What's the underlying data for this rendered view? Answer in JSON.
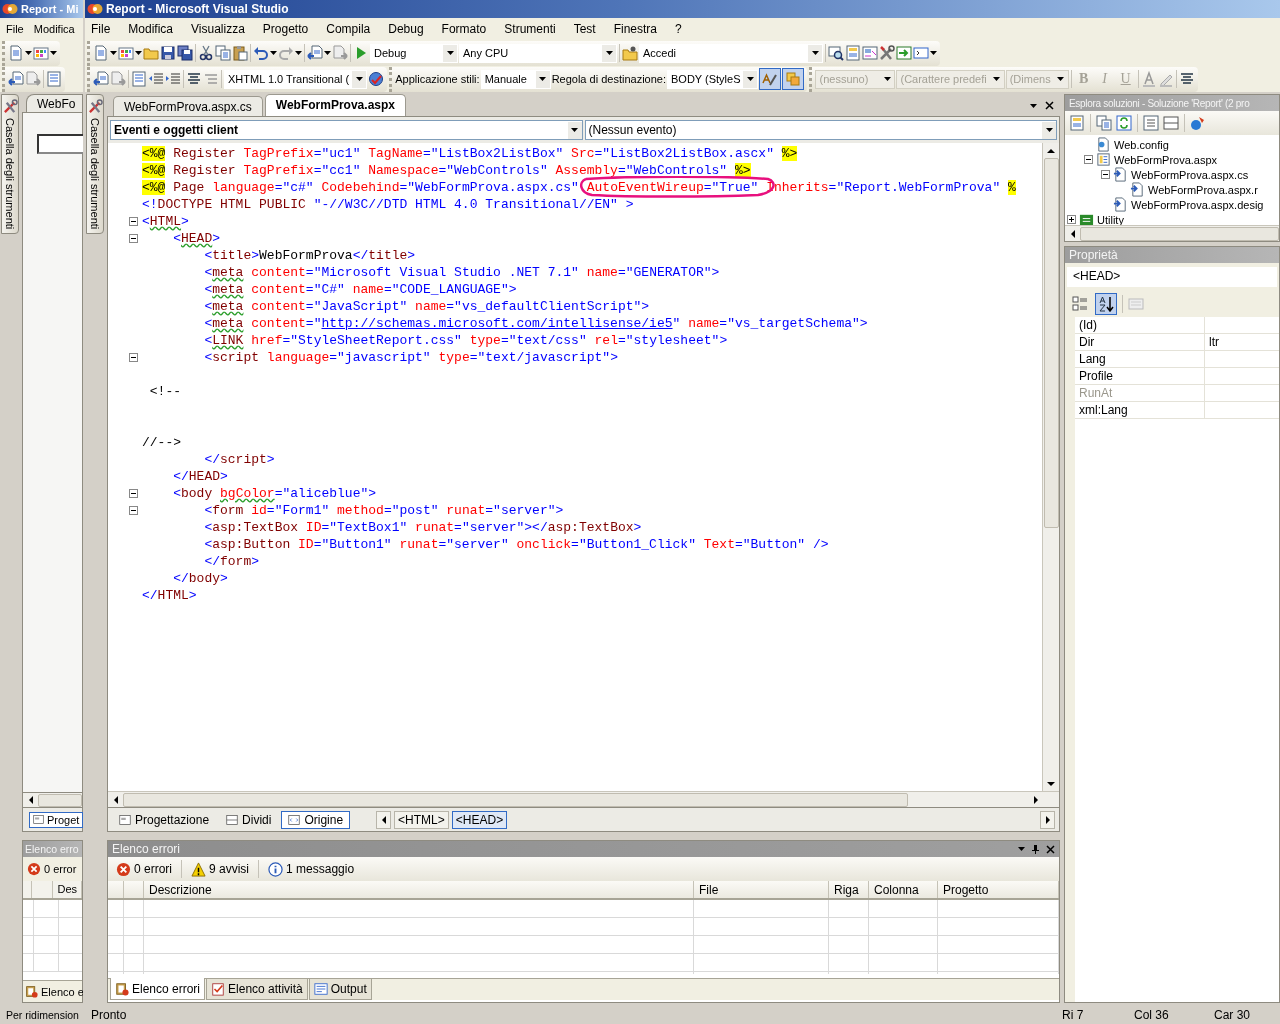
{
  "background_window": {
    "title": "Report - Mi",
    "menu": [
      "File",
      "Modifica"
    ],
    "toolbox_label": "Casella degli strumenti",
    "document_tab": "WebFo",
    "view_tab": "Proget",
    "error_list": {
      "title": "Elenco erro",
      "errors": "0 error",
      "column": "Des",
      "tab": "Elenco e"
    },
    "status": "Per ridimension"
  },
  "window": {
    "title": "Report - Microsoft Visual Studio"
  },
  "menu": [
    "File",
    "Modifica",
    "Visualizza",
    "Progetto",
    "Compila",
    "Debug",
    "Formato",
    "Strumenti",
    "Test",
    "Finestra",
    "?"
  ],
  "toolbars": [
    {
      "items": [
        {
          "kind": "combo",
          "value": "Debug",
          "disabled": false
        },
        {
          "kind": "combo",
          "value": "Any CPU",
          "disabled": false
        },
        {
          "kind": "combo",
          "value": "Accedi",
          "disabled": false
        }
      ]
    },
    {
      "items": [
        {
          "kind": "combo",
          "value": "XHTML 1.0 Transitional (",
          "disabled": false
        },
        {
          "kind": "label",
          "text": "Applicazione stili:"
        },
        {
          "kind": "combo",
          "value": "Manuale",
          "disabled": false
        },
        {
          "kind": "label",
          "text": "Regola di destinazione:"
        },
        {
          "kind": "combo",
          "value": "BODY (StyleS",
          "disabled": false
        },
        {
          "kind": "toggle",
          "on": true
        },
        {
          "kind": "toggle",
          "on": true
        },
        {
          "kind": "combo",
          "value": "(nessuno)",
          "disabled": true
        },
        {
          "kind": "combo",
          "value": "(Carattere predefi",
          "disabled": true
        },
        {
          "kind": "combo",
          "value": "(Dimens",
          "disabled": true
        },
        {
          "kind": "button",
          "label": "B",
          "disabled": true
        },
        {
          "kind": "button",
          "label": "I",
          "disabled": true
        },
        {
          "kind": "button",
          "label": "U",
          "disabled": true
        }
      ]
    }
  ],
  "toolbox_label": "Casella degli strumenti",
  "document_tabs": [
    {
      "label": "WebFormProva.aspx.cs",
      "selected": false
    },
    {
      "label": "WebFormProva.aspx",
      "selected": true
    }
  ],
  "object_combo": "Eventi e oggetti client",
  "event_combo": "(Nessun evento)",
  "code_lines": [
    {
      "fold": false,
      "tokens": [
        {
          "text": "<%@",
          "kind": "directive"
        },
        {
          "text": " Register",
          "kind": "tag"
        },
        {
          "text": " TagPrefix",
          "kind": "attr"
        },
        {
          "text": "=\"uc1\"",
          "kind": "value"
        },
        {
          "text": " TagName",
          "kind": "attr"
        },
        {
          "text": "=\"ListBox2ListBox\"",
          "kind": "value"
        },
        {
          "text": " Src",
          "kind": "attr"
        },
        {
          "text": "=\"ListBox2ListBox.ascx\" ",
          "kind": "value"
        },
        {
          "text": "%>",
          "kind": "directive"
        }
      ]
    },
    {
      "fold": false,
      "tokens": [
        {
          "text": "<%@",
          "kind": "directive"
        },
        {
          "text": " Register",
          "kind": "tag"
        },
        {
          "text": " TagPrefix",
          "kind": "attr"
        },
        {
          "text": "=\"cc1\"",
          "kind": "value"
        },
        {
          "text": " Namespace",
          "kind": "attr"
        },
        {
          "text": "=\"WebControls\"",
          "kind": "value"
        },
        {
          "text": " Assembly",
          "kind": "attr"
        },
        {
          "text": "=\"WebControls\" ",
          "kind": "value"
        },
        {
          "text": "%>",
          "kind": "directive"
        }
      ]
    },
    {
      "fold": false,
      "tokens": [
        {
          "text": "<%@",
          "kind": "directive"
        },
        {
          "text": " Page",
          "kind": "tag"
        },
        {
          "text": " language",
          "kind": "attr"
        },
        {
          "text": "=\"c#\"",
          "kind": "value"
        },
        {
          "text": " Codebehind",
          "kind": "attr"
        },
        {
          "text": "=\"WebFormProva.aspx.cs\"",
          "kind": "value"
        },
        {
          "text": " AutoEventWireup",
          "kind": "attr"
        },
        {
          "text": "=\"True\"",
          "kind": "value"
        },
        {
          "text": " Inherits",
          "kind": "attr"
        },
        {
          "text": "=\"Report.WebFormProva\" ",
          "kind": "value"
        },
        {
          "text": "%",
          "kind": "directive"
        }
      ]
    },
    {
      "fold": false,
      "tokens": [
        {
          "text": "<!",
          "kind": "delim"
        },
        {
          "text": "DOCTYPE HTML PUBLIC",
          "kind": "tag"
        },
        {
          "text": " \"-//W3C//DTD HTML 4.0 Transitional//EN\"",
          "kind": "value"
        },
        {
          "text": " >",
          "kind": "delim"
        }
      ]
    },
    {
      "fold": true,
      "tokens": [
        {
          "text": "<",
          "kind": "delim"
        },
        {
          "text": "HTML",
          "kind": "tagwarn"
        },
        {
          "text": ">",
          "kind": "delim"
        }
      ]
    },
    {
      "fold": true,
      "tokens": [
        {
          "text": "    <",
          "kind": "delim"
        },
        {
          "text": "HEAD",
          "kind": "tagwarn"
        },
        {
          "text": ">",
          "kind": "delim"
        }
      ]
    },
    {
      "fold": false,
      "tokens": [
        {
          "text": "        <",
          "kind": "delim"
        },
        {
          "text": "title",
          "kind": "tag"
        },
        {
          "text": ">",
          "kind": "delim"
        },
        {
          "text": "WebFormProva",
          "kind": "text"
        },
        {
          "text": "</",
          "kind": "delim"
        },
        {
          "text": "title",
          "kind": "tag"
        },
        {
          "text": ">",
          "kind": "delim"
        }
      ]
    },
    {
      "fold": false,
      "tokens": [
        {
          "text": "        <",
          "kind": "delim"
        },
        {
          "text": "meta",
          "kind": "tagwarn"
        },
        {
          "text": " content",
          "kind": "attr"
        },
        {
          "text": "=\"Microsoft Visual Studio .NET 7.1\"",
          "kind": "value"
        },
        {
          "text": " name",
          "kind": "attr"
        },
        {
          "text": "=\"GENERATOR\"",
          "kind": "value"
        },
        {
          "text": ">",
          "kind": "delim"
        }
      ]
    },
    {
      "fold": false,
      "tokens": [
        {
          "text": "        <",
          "kind": "delim"
        },
        {
          "text": "meta",
          "kind": "tagwarn"
        },
        {
          "text": " content",
          "kind": "attr"
        },
        {
          "text": "=\"C#\"",
          "kind": "value"
        },
        {
          "text": " name",
          "kind": "attr"
        },
        {
          "text": "=\"CODE_LANGUAGE\"",
          "kind": "value"
        },
        {
          "text": ">",
          "kind": "delim"
        }
      ]
    },
    {
      "fold": false,
      "tokens": [
        {
          "text": "        <",
          "kind": "delim"
        },
        {
          "text": "meta",
          "kind": "tagwarn"
        },
        {
          "text": " content",
          "kind": "attr"
        },
        {
          "text": "=\"JavaScript\"",
          "kind": "value"
        },
        {
          "text": " name",
          "kind": "attr"
        },
        {
          "text": "=\"vs_defaultClientScript\"",
          "kind": "value"
        },
        {
          "text": ">",
          "kind": "delim"
        }
      ]
    },
    {
      "fold": false,
      "tokens": [
        {
          "text": "        <",
          "kind": "delim"
        },
        {
          "text": "meta",
          "kind": "tagwarn"
        },
        {
          "text": " content",
          "kind": "attr"
        },
        {
          "text": "=\"",
          "kind": "value"
        },
        {
          "text": "http://schemas.microsoft.com/intellisense/ie5",
          "kind": "link"
        },
        {
          "text": "\"",
          "kind": "value"
        },
        {
          "text": " name",
          "kind": "attr"
        },
        {
          "text": "=\"vs_targetSchema\"",
          "kind": "value"
        },
        {
          "text": ">",
          "kind": "delim"
        }
      ]
    },
    {
      "fold": false,
      "tokens": [
        {
          "text": "        <",
          "kind": "delim"
        },
        {
          "text": "LINK",
          "kind": "tagwarn"
        },
        {
          "text": " href",
          "kind": "attr"
        },
        {
          "text": "=\"StyleSheetReport.css\"",
          "kind": "value"
        },
        {
          "text": " type",
          "kind": "attr"
        },
        {
          "text": "=\"text/css\"",
          "kind": "value"
        },
        {
          "text": " rel",
          "kind": "attr"
        },
        {
          "text": "=\"stylesheet\"",
          "kind": "value"
        },
        {
          "text": ">",
          "kind": "delim"
        }
      ]
    },
    {
      "fold": true,
      "tokens": [
        {
          "text": "        <",
          "kind": "delim"
        },
        {
          "text": "script",
          "kind": "tag"
        },
        {
          "text": " language",
          "kind": "attr"
        },
        {
          "text": "=\"javascript\"",
          "kind": "value"
        },
        {
          "text": " type",
          "kind": "attr"
        },
        {
          "text": "=\"text/javascript\"",
          "kind": "value"
        },
        {
          "text": ">",
          "kind": "delim"
        }
      ]
    },
    {
      "fold": false
    },
    {
      "fold": false,
      "tokens": [
        {
          "text": " <!--",
          "kind": "text"
        }
      ]
    },
    {
      "fold": false
    },
    {
      "fold": false
    },
    {
      "fold": false,
      "tokens": [
        {
          "text": "//-->",
          "kind": "text"
        }
      ]
    },
    {
      "fold": false,
      "tokens": [
        {
          "text": "        </",
          "kind": "delim"
        },
        {
          "text": "script",
          "kind": "tag"
        },
        {
          "text": ">",
          "kind": "delim"
        }
      ]
    },
    {
      "fold": false,
      "tokens": [
        {
          "text": "    </",
          "kind": "delim"
        },
        {
          "text": "HEAD",
          "kind": "tag"
        },
        {
          "text": ">",
          "kind": "delim"
        }
      ]
    },
    {
      "fold": true,
      "tokens": [
        {
          "text": "    <",
          "kind": "delim"
        },
        {
          "text": "body ",
          "kind": "tag"
        },
        {
          "text": "bgColor",
          "kind": "attrwarn"
        },
        {
          "text": "=\"aliceblue\"",
          "kind": "value"
        },
        {
          "text": ">",
          "kind": "delim"
        }
      ]
    },
    {
      "fold": true,
      "tokens": [
        {
          "text": "        <",
          "kind": "delim"
        },
        {
          "text": "form",
          "kind": "tag"
        },
        {
          "text": " id",
          "kind": "attr"
        },
        {
          "text": "=\"Form1\"",
          "kind": "value"
        },
        {
          "text": " method",
          "kind": "attr"
        },
        {
          "text": "=\"post\"",
          "kind": "value"
        },
        {
          "text": " runat",
          "kind": "attr"
        },
        {
          "text": "=\"server\"",
          "kind": "value"
        },
        {
          "text": ">",
          "kind": "delim"
        }
      ]
    },
    {
      "fold": false,
      "tokens": [
        {
          "text": "        <",
          "kind": "delim"
        },
        {
          "text": "asp:TextBox",
          "kind": "tag"
        },
        {
          "text": " ID",
          "kind": "attr"
        },
        {
          "text": "=\"TextBox1\"",
          "kind": "value"
        },
        {
          "text": " runat",
          "kind": "attr"
        },
        {
          "text": "=\"server\"",
          "kind": "value"
        },
        {
          "text": "></",
          "kind": "delim"
        },
        {
          "text": "asp:TextBox",
          "kind": "tag"
        },
        {
          "text": ">",
          "kind": "delim"
        }
      ]
    },
    {
      "fold": false,
      "tokens": [
        {
          "text": "        <",
          "kind": "delim"
        },
        {
          "text": "asp:Button",
          "kind": "tag"
        },
        {
          "text": " ID",
          "kind": "attr"
        },
        {
          "text": "=\"Button1\"",
          "kind": "value"
        },
        {
          "text": " runat",
          "kind": "attr"
        },
        {
          "text": "=\"server\"",
          "kind": "value"
        },
        {
          "text": " onclick",
          "kind": "attr"
        },
        {
          "text": "=\"Button1_Click\"",
          "kind": "value"
        },
        {
          "text": " Text",
          "kind": "attr"
        },
        {
          "text": "=\"Button\"",
          "kind": "value"
        },
        {
          "text": " />",
          "kind": "delim"
        }
      ]
    },
    {
      "fold": false,
      "tokens": [
        {
          "text": "        </",
          "kind": "delim"
        },
        {
          "text": "form",
          "kind": "tag"
        },
        {
          "text": ">",
          "kind": "delim"
        }
      ]
    },
    {
      "fold": false,
      "tokens": [
        {
          "text": "    </",
          "kind": "delim"
        },
        {
          "text": "body",
          "kind": "tag"
        },
        {
          "text": ">",
          "kind": "delim"
        }
      ]
    },
    {
      "fold": false,
      "tokens": [
        {
          "text": "</",
          "kind": "delim"
        },
        {
          "text": "HTML",
          "kind": "tag"
        },
        {
          "text": ">",
          "kind": "delim"
        }
      ]
    }
  ],
  "view_tabs": [
    {
      "label": "Progettazione",
      "selected": false
    },
    {
      "label": "Dividi",
      "selected": false
    },
    {
      "label": "Origine",
      "selected": true
    }
  ],
  "tag_path": [
    {
      "label": "<HTML>",
      "selected": false
    },
    {
      "label": "<HEAD>",
      "selected": true
    }
  ],
  "error_list": {
    "title": "Elenco errori",
    "filters": [
      {
        "kind": "error",
        "label": "0 errori"
      },
      {
        "kind": "warning",
        "label": "9 avvisi"
      },
      {
        "kind": "info",
        "label": "1 messaggio"
      }
    ],
    "columns": [
      "Descrizione",
      "File",
      "Riga",
      "Colonna",
      "Progetto"
    ],
    "tabs": [
      {
        "label": "Elenco errori",
        "selected": true
      },
      {
        "label": "Elenco attività",
        "selected": false
      },
      {
        "label": "Output",
        "selected": false
      }
    ]
  },
  "solution_explorer": {
    "title": "Esplora soluzioni - Soluzione 'Report'  (2 pro",
    "tree": [
      {
        "children": [
          {
            "label": "Web.config"
          },
          {
            "label": "WebFormProva.aspx",
            "expanded": true,
            "children": [
              {
                "label": "WebFormProva.aspx.cs",
                "expanded": true,
                "children": [
                  {
                    "label": "WebFormProva.aspx.r"
                  }
                ]
              },
              {
                "label": "WebFormProva.aspx.desig"
              }
            ]
          }
        ]
      },
      {
        "label": "Utility",
        "expanded": false
      }
    ]
  },
  "properties": {
    "title": "Proprietà",
    "object": "<HEAD>",
    "sort_buttons": [
      {
        "kind": "categorized",
        "selected": false
      },
      {
        "kind": "alphabetical",
        "selected": true
      }
    ],
    "rows": [
      {
        "name": "(Id)",
        "disabled": false
      },
      {
        "name": "Dir",
        "value": "ltr",
        "disabled": false
      },
      {
        "name": "Lang",
        "disabled": false
      },
      {
        "name": "Profile",
        "disabled": false
      },
      {
        "name": "RunAt",
        "disabled": true
      },
      {
        "name": "xml:Lang",
        "disabled": false
      }
    ]
  },
  "status_bar": {
    "message": "Pronto",
    "line": "Ri 7",
    "column": "Col 36",
    "char": "Car 30"
  }
}
